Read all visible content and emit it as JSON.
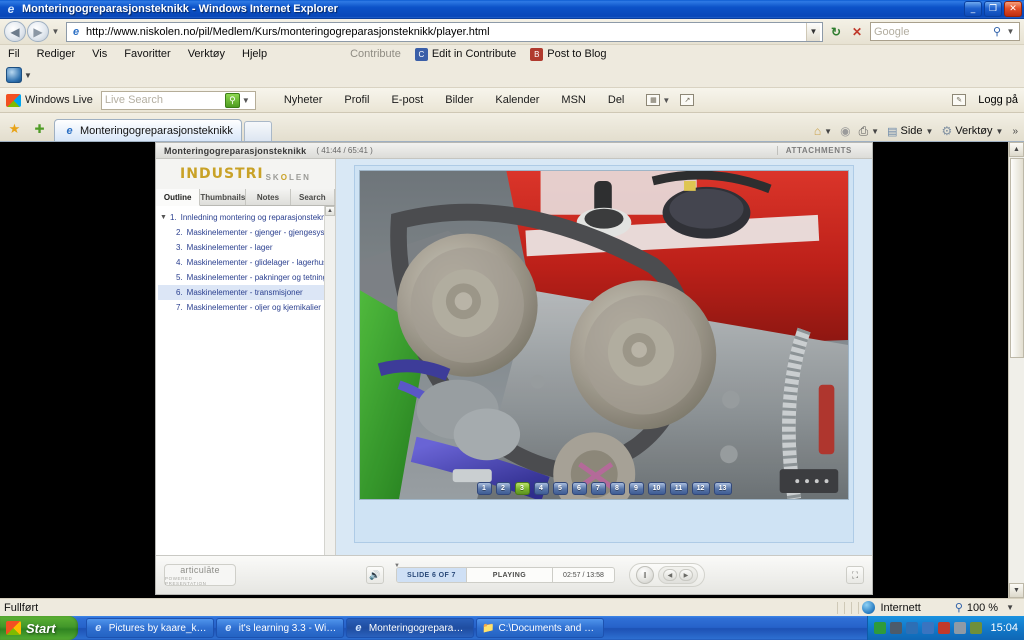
{
  "window": {
    "title": "Monteringogreparasjonsteknikk - Windows Internet Explorer",
    "icon": "ie-icon",
    "minimize_label": "_",
    "restore_label": "❐",
    "close_label": "✕"
  },
  "nav": {
    "back_icon": "◀",
    "forward_icon": "▶",
    "history_caret": "▼",
    "address_value": "http://www.niskolen.no/pil/Medlem/Kurs/monteringogreparasjonsteknikk/player.html",
    "address_icon": "page-icon",
    "address_caret": "▼",
    "refresh_icon": "↻",
    "stop_icon": "✕",
    "search_placeholder": "Google",
    "search_go_icon": "⚲",
    "search_caret": "▼"
  },
  "menu": {
    "items": [
      "Fil",
      "Rediger",
      "Vis",
      "Favoritter",
      "Verktøy",
      "Hjelp"
    ],
    "right": [
      {
        "label": "Contribute",
        "dim": true
      },
      {
        "label": "Edit in Contribute",
        "dim": false
      },
      {
        "label": "Post to Blog",
        "dim": false
      }
    ]
  },
  "contribute_bar": {
    "icon": "contribute-icon",
    "caret": "▼"
  },
  "windows_live": {
    "brand": "Windows Live",
    "search_placeholder": "Live Search",
    "search_caret": "▼",
    "links": [
      "Nyheter",
      "Profil",
      "E-post",
      "Bilder",
      "Kalender",
      "MSN",
      "Del"
    ],
    "right_caret": "▼",
    "signin_label": "Logg på"
  },
  "tabs": {
    "favorites_icon": "star-icon",
    "add_favorite_icon": "add-favorite-icon",
    "items": [
      {
        "label": "Monteringogreparasjonsteknikk",
        "active": true
      }
    ],
    "toolbar_right": [
      {
        "name": "home",
        "label": "",
        "icon": "⌂",
        "caret": "▼"
      },
      {
        "name": "feeds",
        "label": "",
        "icon": "◉",
        "caret": ""
      },
      {
        "name": "print",
        "label": "",
        "icon": "⎙",
        "caret": "▼"
      },
      {
        "name": "page",
        "label": "Side",
        "icon": "▤",
        "caret": "▼"
      },
      {
        "name": "tools",
        "label": "Verktøy",
        "icon": "⚙",
        "caret": "▼"
      }
    ],
    "overflow_icon": "»"
  },
  "player": {
    "title": "Monteringogreparasjonsteknikk",
    "time_range": "( 41:44 / 65:41 )",
    "attachments_label": "ATTACHMENTS",
    "brand_main": "INDUSTRI",
    "brand_sub_1": "SK",
    "brand_sub_2": "O",
    "brand_sub_3": "LEN",
    "tabs": [
      {
        "label": "Outline",
        "active": true
      },
      {
        "label": "Thumbnails",
        "active": false
      },
      {
        "label": "Notes",
        "active": false
      },
      {
        "label": "Search",
        "active": false
      }
    ],
    "outline": [
      {
        "num": "1.",
        "label": "Innledning montering og reparasjonsteknikk",
        "level": 1,
        "selected": false,
        "toggle": "▼"
      },
      {
        "num": "2.",
        "label": "Maskinelementer - gjenger - gjengesyste",
        "level": 2,
        "selected": false,
        "toggle": ""
      },
      {
        "num": "3.",
        "label": "Maskinelementer - lager",
        "level": 2,
        "selected": false,
        "toggle": ""
      },
      {
        "num": "4.",
        "label": "Maskinelementer - glidelager - lagerhus -",
        "level": 2,
        "selected": false,
        "toggle": ""
      },
      {
        "num": "5.",
        "label": "Maskinelementer - pakninger og tetninge",
        "level": 2,
        "selected": false,
        "toggle": ""
      },
      {
        "num": "6.",
        "label": "Maskinelementer - transmisjoner",
        "level": 2,
        "selected": true,
        "toggle": ""
      },
      {
        "num": "7.",
        "label": "Maskinelementer - oljer og kjemikalier",
        "level": 2,
        "selected": false,
        "toggle": ""
      }
    ],
    "outline_scroll_up": "▲",
    "outline_scroll_down": "▼",
    "slide_nav": [
      {
        "label": "1",
        "active": false
      },
      {
        "label": "2",
        "active": false
      },
      {
        "label": "3",
        "active": true
      },
      {
        "label": "4",
        "active": false
      },
      {
        "label": "5",
        "active": false
      },
      {
        "label": "6",
        "active": false
      },
      {
        "label": "7",
        "active": false
      },
      {
        "label": "8",
        "active": false
      },
      {
        "label": "9",
        "active": false
      },
      {
        "label": "10",
        "active": false
      },
      {
        "label": "11",
        "active": false
      },
      {
        "label": "12",
        "active": false
      },
      {
        "label": "13",
        "active": false
      }
    ],
    "slide_image_alt": "Car engine with drive belt and pulleys, red valve cover, blue coolant hoses",
    "footer": {
      "logo_line1": "articulāte",
      "logo_line2": "POWERED PRESENTATION",
      "volume_icon": "ᐧ))",
      "slide_counter": "SLIDE 6 OF 7",
      "state": "PLAYING",
      "time": "02:57 / 13:58",
      "seek_marker": "▼",
      "pause_icon": "‖",
      "prev_icon": "◀",
      "next_icon": "▶",
      "fullscreen_icon": "⛶"
    }
  },
  "scrollbar": {
    "up_icon": "▲",
    "down_icon": "▼"
  },
  "statusbar": {
    "message": "Fullført",
    "zone_icon": "globe-icon",
    "zone": "Internett",
    "zoom_icon": "⚲",
    "zoom_level": "100 %",
    "zoom_caret": "▼"
  },
  "taskbar": {
    "start_label": "Start",
    "tasks": [
      {
        "label": "Pictures by kaare_ka...",
        "icon": "ie-icon",
        "active": false
      },
      {
        "label": "it's learning 3.3 - Win...",
        "icon": "ie-icon",
        "active": false
      },
      {
        "label": "Monteringogreparasj...",
        "icon": "ie-icon",
        "active": true
      },
      {
        "label": "C:\\Documents and Se...",
        "icon": "folder-icon",
        "active": false
      }
    ],
    "tray_icons": [
      "shield-icon",
      "network-icon",
      "sound-icon",
      "display-icon",
      "messenger-icon",
      "security-icon",
      "update-icon"
    ],
    "clock": "15:04"
  }
}
